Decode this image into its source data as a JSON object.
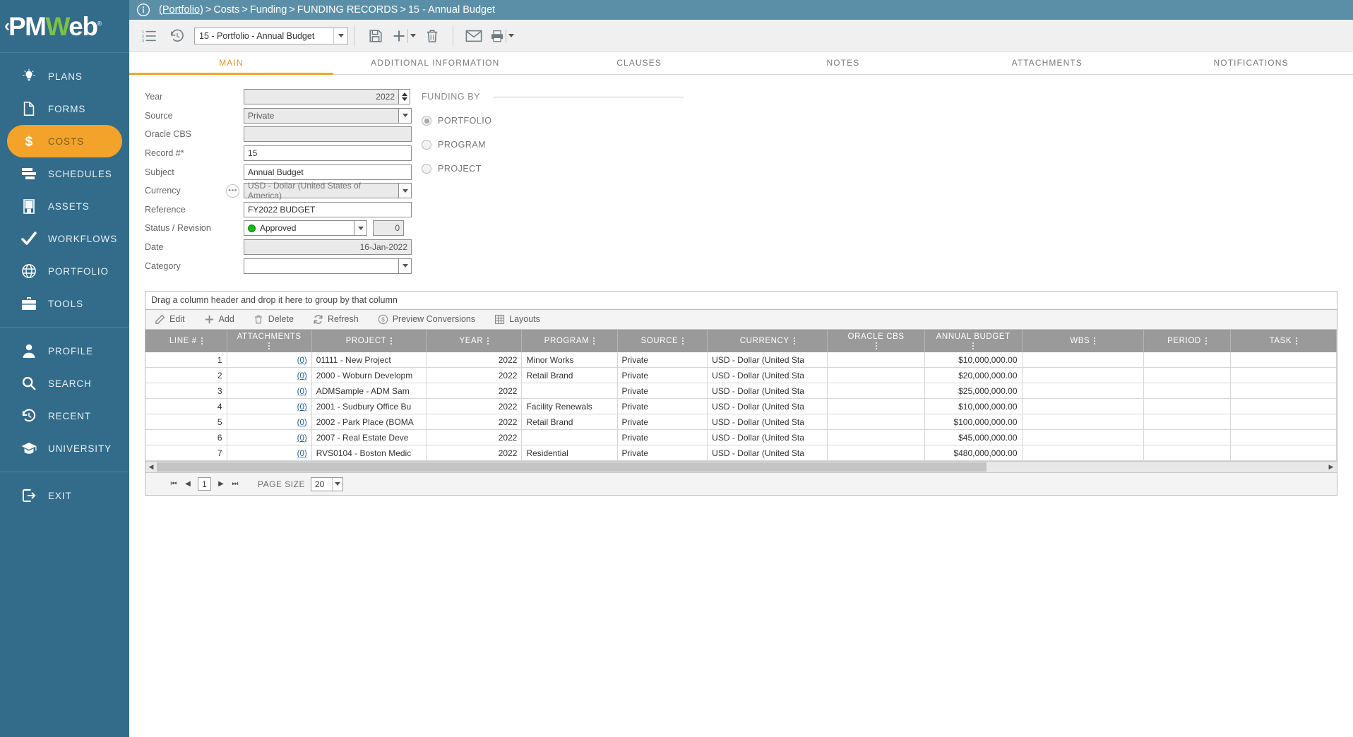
{
  "sidebar": {
    "logo": {
      "prefix": "PM",
      "accent": "W",
      "suffix": "eb",
      "chevron": "‹"
    },
    "items": [
      {
        "label": "PLANS",
        "icon": "lightbulb-icon",
        "active": false
      },
      {
        "label": "FORMS",
        "icon": "document-icon",
        "active": false
      },
      {
        "label": "COSTS",
        "icon": "dollar-icon",
        "active": true
      },
      {
        "label": "SCHEDULES",
        "icon": "gantt-icon",
        "active": false
      },
      {
        "label": "ASSETS",
        "icon": "building-icon",
        "active": false
      },
      {
        "label": "WORKFLOWS",
        "icon": "check-icon",
        "active": false
      },
      {
        "label": "PORTFOLIO",
        "icon": "globe-icon",
        "active": false
      },
      {
        "label": "TOOLS",
        "icon": "briefcase-icon",
        "active": false
      }
    ],
    "items2": [
      {
        "label": "PROFILE",
        "icon": "user-icon"
      },
      {
        "label": "SEARCH",
        "icon": "search-icon"
      },
      {
        "label": "RECENT",
        "icon": "history-icon"
      },
      {
        "label": "UNIVERSITY",
        "icon": "graduation-icon"
      }
    ],
    "items3": [
      {
        "label": "EXIT",
        "icon": "exit-icon"
      }
    ]
  },
  "breadcrumb": {
    "root": "(Portfolio)",
    "parts": [
      "Costs",
      "Funding",
      "FUNDING RECORDS",
      "15 - Annual Budget"
    ],
    "separator": ">"
  },
  "toolbar": {
    "record_select": "15 - Portfolio  - Annual Budget",
    "icons": [
      "list-icon",
      "history-icon",
      "save-icon",
      "add-icon",
      "delete-icon",
      "email-icon",
      "print-icon"
    ]
  },
  "tabs": [
    {
      "label": "MAIN",
      "active": true
    },
    {
      "label": "ADDITIONAL INFORMATION",
      "active": false
    },
    {
      "label": "CLAUSES",
      "active": false
    },
    {
      "label": "NOTES",
      "active": false
    },
    {
      "label": "ATTACHMENTS",
      "active": false
    },
    {
      "label": "NOTIFICATIONS",
      "active": false
    }
  ],
  "form": {
    "year": {
      "label": "Year",
      "value": "2022"
    },
    "source": {
      "label": "Source",
      "value": "Private"
    },
    "oracle_cbs": {
      "label": "Oracle CBS",
      "value": ""
    },
    "record_no": {
      "label": "Record #*",
      "value": "15"
    },
    "subject": {
      "label": "Subject",
      "value": "Annual Budget"
    },
    "currency": {
      "label": "Currency",
      "value": "USD - Dollar (United States of America)",
      "ellipsis": "•••"
    },
    "reference": {
      "label": "Reference",
      "value": "FY2022 BUDGET"
    },
    "status": {
      "label": "Status / Revision",
      "value": "Approved",
      "revision": "0",
      "dot_color": "#12bb12"
    },
    "date": {
      "label": "Date",
      "value": "16-Jan-2022"
    },
    "category": {
      "label": "Category",
      "value": ""
    }
  },
  "funding_by": {
    "title": "FUNDING BY",
    "options": [
      {
        "label": "PORTFOLIO",
        "selected": true
      },
      {
        "label": "PROGRAM",
        "selected": false
      },
      {
        "label": "PROJECT",
        "selected": false
      }
    ]
  },
  "grid": {
    "group_hint": "Drag a column header and drop it here to group by that column",
    "toolbar": [
      {
        "label": "Edit",
        "icon": "pencil-icon"
      },
      {
        "label": "Add",
        "icon": "plus-icon"
      },
      {
        "label": "Delete",
        "icon": "trash-icon"
      },
      {
        "label": "Refresh",
        "icon": "refresh-icon"
      },
      {
        "label": "Preview Conversions",
        "icon": "dollar-circle-icon"
      },
      {
        "label": "Layouts",
        "icon": "grid-icon"
      }
    ],
    "columns": [
      "LINE #",
      "ATTACHMENTS",
      "PROJECT",
      "YEAR",
      "PROGRAM",
      "SOURCE",
      "CURRENCY",
      "ORACLE CBS",
      "ANNUAL BUDGET",
      "WBS",
      "PERIOD",
      "TASK"
    ],
    "rows": [
      {
        "line": "1",
        "attachments": "(0)",
        "project": "01111 - New Project",
        "year": "2022",
        "program": "Minor Works",
        "source": "Private",
        "currency": "USD - Dollar (United Sta",
        "oracle_cbs": "",
        "budget": "$10,000,000.00",
        "wbs": "",
        "period": "",
        "task": ""
      },
      {
        "line": "2",
        "attachments": "(0)",
        "project": "2000 - Woburn Developm",
        "year": "2022",
        "program": "Retail Brand",
        "source": "Private",
        "currency": "USD - Dollar (United Sta",
        "oracle_cbs": "",
        "budget": "$20,000,000.00",
        "wbs": "",
        "period": "",
        "task": ""
      },
      {
        "line": "3",
        "attachments": "(0)",
        "project": "ADMSample - ADM Sam",
        "year": "2022",
        "program": "",
        "source": "Private",
        "currency": "USD - Dollar (United Sta",
        "oracle_cbs": "",
        "budget": "$25,000,000.00",
        "wbs": "",
        "period": "",
        "task": ""
      },
      {
        "line": "4",
        "attachments": "(0)",
        "project": "2001 - Sudbury Office Bu",
        "year": "2022",
        "program": "Facility Renewals",
        "source": "Private",
        "currency": "USD - Dollar (United Sta",
        "oracle_cbs": "",
        "budget": "$10,000,000.00",
        "wbs": "",
        "period": "",
        "task": ""
      },
      {
        "line": "5",
        "attachments": "(0)",
        "project": "2002 - Park Place (BOMA",
        "year": "2022",
        "program": "Retail Brand",
        "source": "Private",
        "currency": "USD - Dollar (United Sta",
        "oracle_cbs": "",
        "budget": "$100,000,000.00",
        "wbs": "",
        "period": "",
        "task": ""
      },
      {
        "line": "6",
        "attachments": "(0)",
        "project": "2007 - Real Estate Deve",
        "year": "2022",
        "program": "",
        "source": "Private",
        "currency": "USD - Dollar (United Sta",
        "oracle_cbs": "",
        "budget": "$45,000,000.00",
        "wbs": "",
        "period": "",
        "task": ""
      },
      {
        "line": "7",
        "attachments": "(0)",
        "project": "RVS0104 - Boston Medic",
        "year": "2022",
        "program": "Residential",
        "source": "Private",
        "currency": "USD - Dollar (United Sta",
        "oracle_cbs": "",
        "budget": "$480,000,000.00",
        "wbs": "",
        "period": "",
        "task": ""
      }
    ],
    "pager": {
      "first": "▌◀",
      "prev": "◀",
      "next": "▶",
      "last": "▶▐",
      "current_page": "1",
      "page_size_label": "PAGE SIZE",
      "page_size": "20"
    }
  },
  "colors": {
    "sidebar_bg": "#336b8a",
    "accent_orange": "#f3a32a",
    "breadcrumb_bg": "#5b8fa8",
    "grid_header": "#9a9a9a",
    "status_green": "#12bb12"
  }
}
